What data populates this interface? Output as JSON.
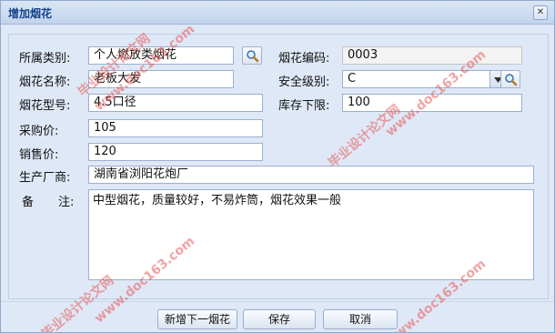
{
  "window": {
    "title": "增加烟花"
  },
  "form": {
    "category": {
      "label": "所属类别:",
      "value": "个人燃放类烟花"
    },
    "code": {
      "label": "烟花编码:",
      "value": "0003"
    },
    "name": {
      "label": "烟花名称:",
      "value": "老板大发"
    },
    "safety_level": {
      "label": "安全级别:",
      "value": "C"
    },
    "model": {
      "label": "烟花型号:",
      "value": "4.5口径"
    },
    "stock_min": {
      "label": "库存下限:",
      "value": "100"
    },
    "purchase_price": {
      "label": "采购价:",
      "value": "105"
    },
    "sale_price": {
      "label": "销售价:",
      "value": "120"
    },
    "manufacturer": {
      "label": "生产厂商:",
      "value": "湖南省浏阳花炮厂"
    },
    "remarks": {
      "label_left": "备",
      "label_right": "注:",
      "value": "中型烟花，质量较好，不易炸筒，烟花效果一般"
    }
  },
  "buttons": {
    "add_next": "新增下一烟花",
    "save": "保存",
    "cancel": "取消"
  },
  "watermarks": {
    "cn": "毕业设计论文网",
    "url": "www.doc163.com"
  },
  "colors": {
    "title_text": "#15428b",
    "panel_bg": "#dfe8f6",
    "watermark": "#e65a5a"
  }
}
